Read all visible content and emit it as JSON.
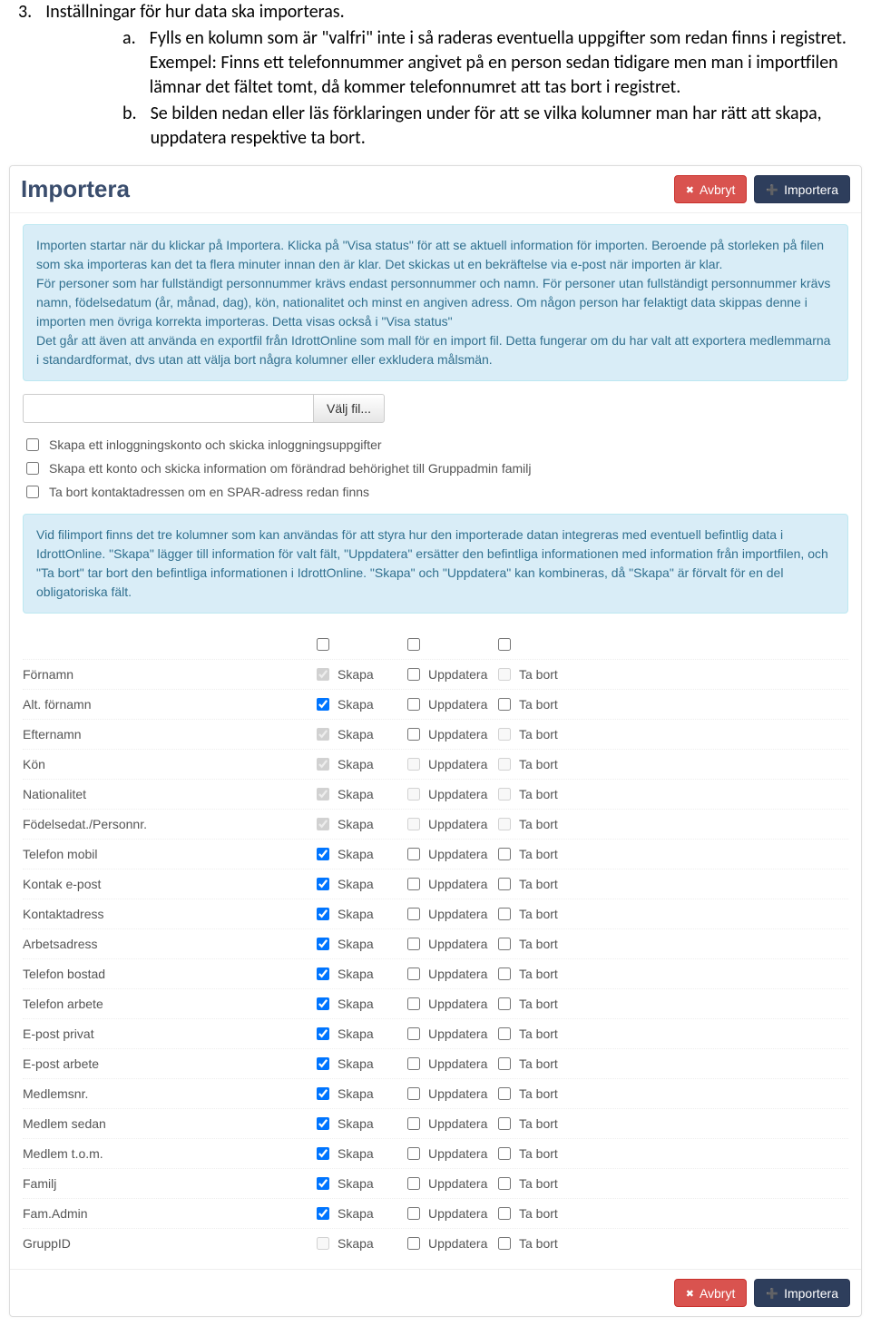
{
  "doc": {
    "item_number": "3.",
    "item_text": "Inställningar för hur data ska importeras.",
    "letter_a": "a.",
    "text_a": "Fylls en kolumn som är \"valfri\" inte i så raderas eventuella uppgifter som redan finns i registret. Exempel: Finns ett telefonnummer angivet på en person sedan tidigare men man i importfilen lämnar det fältet tomt, då kommer telefonnumret att tas bort i registret.",
    "letter_b": "b.",
    "text_b": "Se bilden nedan eller läs förklaringen under för att se vilka kolumner man har rätt att skapa, uppdatera respektive ta bort."
  },
  "panel": {
    "title": "Importera",
    "cancel_label": "Avbryt",
    "import_label": "Importera",
    "info1": "Importen startar när du klickar på Importera. Klicka på \"Visa status\" för att se aktuell information för importen. Beroende på storleken på filen som ska importeras kan det ta flera minuter innan den är klar. Det skickas ut en bekräftelse via e-post när importen är klar.\nFör personer som har fullständigt personnummer krävs endast personnummer och namn. För personer utan fullständigt personnummer krävs namn, födelsedatum (år, månad, dag), kön, nationalitet och minst en angiven adress. Om någon person har felaktigt data skippas denne i importen men övriga korrekta importeras. Detta visas också i \"Visa status\"\nDet går att även att använda en exportfil från IdrottOnline som mall för en import fil. Detta fungerar om du har valt att exportera medlemmarna i standardformat, dvs utan att välja bort några kolumner eller exkludera målsmän.",
    "choose_file": "Välj fil...",
    "check1": "Skapa ett inloggningskonto och skicka inloggningsuppgifter",
    "check2": "Skapa ett konto och skicka information om förändrad behörighet till Gruppadmin familj",
    "check3": "Ta bort kontaktadressen om en SPAR-adress redan finns",
    "info2": "Vid filimport finns det tre kolumner som kan användas för att styra hur den importerade datan integreras med eventuell befintlig data i IdrottOnline. \"Skapa\" lägger till information för valt fält, \"Uppdatera\" ersätter den befintliga informationen med information från importfilen, och \"Ta bort\" tar bort den befintliga informationen i IdrottOnline. \"Skapa\" och \"Uppdatera\" kan kombineras, då \"Skapa\" är förvalt för en del obligatoriska fält.",
    "col_skapa": "Skapa",
    "col_uppdatera": "Uppdatera",
    "col_tabort": "Ta bort",
    "rows": [
      {
        "label": "Förnamn",
        "skapa": true,
        "skapa_enabled": false,
        "uppdatera": false,
        "uppdatera_enabled": true,
        "tabort": false,
        "tabort_enabled": false
      },
      {
        "label": "Alt. förnamn",
        "skapa": true,
        "skapa_enabled": true,
        "uppdatera": false,
        "uppdatera_enabled": true,
        "tabort": false,
        "tabort_enabled": true
      },
      {
        "label": "Efternamn",
        "skapa": true,
        "skapa_enabled": false,
        "uppdatera": false,
        "uppdatera_enabled": true,
        "tabort": false,
        "tabort_enabled": false
      },
      {
        "label": "Kön",
        "skapa": true,
        "skapa_enabled": false,
        "uppdatera": false,
        "uppdatera_enabled": false,
        "tabort": false,
        "tabort_enabled": false
      },
      {
        "label": "Nationalitet",
        "skapa": true,
        "skapa_enabled": false,
        "uppdatera": false,
        "uppdatera_enabled": false,
        "tabort": false,
        "tabort_enabled": false
      },
      {
        "label": "Födelsedat./Personnr.",
        "skapa": true,
        "skapa_enabled": false,
        "uppdatera": false,
        "uppdatera_enabled": false,
        "tabort": false,
        "tabort_enabled": false
      },
      {
        "label": "Telefon mobil",
        "skapa": true,
        "skapa_enabled": true,
        "uppdatera": false,
        "uppdatera_enabled": true,
        "tabort": false,
        "tabort_enabled": true
      },
      {
        "label": "Kontak e-post",
        "skapa": true,
        "skapa_enabled": true,
        "uppdatera": false,
        "uppdatera_enabled": true,
        "tabort": false,
        "tabort_enabled": true
      },
      {
        "label": "Kontaktadress",
        "skapa": true,
        "skapa_enabled": true,
        "uppdatera": false,
        "uppdatera_enabled": true,
        "tabort": false,
        "tabort_enabled": true
      },
      {
        "label": "Arbetsadress",
        "skapa": true,
        "skapa_enabled": true,
        "uppdatera": false,
        "uppdatera_enabled": true,
        "tabort": false,
        "tabort_enabled": true
      },
      {
        "label": "Telefon bostad",
        "skapa": true,
        "skapa_enabled": true,
        "uppdatera": false,
        "uppdatera_enabled": true,
        "tabort": false,
        "tabort_enabled": true
      },
      {
        "label": "Telefon arbete",
        "skapa": true,
        "skapa_enabled": true,
        "uppdatera": false,
        "uppdatera_enabled": true,
        "tabort": false,
        "tabort_enabled": true
      },
      {
        "label": "E-post privat",
        "skapa": true,
        "skapa_enabled": true,
        "uppdatera": false,
        "uppdatera_enabled": true,
        "tabort": false,
        "tabort_enabled": true
      },
      {
        "label": "E-post arbete",
        "skapa": true,
        "skapa_enabled": true,
        "uppdatera": false,
        "uppdatera_enabled": true,
        "tabort": false,
        "tabort_enabled": true
      },
      {
        "label": "Medlemsnr.",
        "skapa": true,
        "skapa_enabled": true,
        "uppdatera": false,
        "uppdatera_enabled": true,
        "tabort": false,
        "tabort_enabled": true
      },
      {
        "label": "Medlem sedan",
        "skapa": true,
        "skapa_enabled": true,
        "uppdatera": false,
        "uppdatera_enabled": true,
        "tabort": false,
        "tabort_enabled": true
      },
      {
        "label": "Medlem t.o.m.",
        "skapa": true,
        "skapa_enabled": true,
        "uppdatera": false,
        "uppdatera_enabled": true,
        "tabort": false,
        "tabort_enabled": true
      },
      {
        "label": "Familj",
        "skapa": true,
        "skapa_enabled": true,
        "uppdatera": false,
        "uppdatera_enabled": true,
        "tabort": false,
        "tabort_enabled": true
      },
      {
        "label": "Fam.Admin",
        "skapa": true,
        "skapa_enabled": true,
        "uppdatera": false,
        "uppdatera_enabled": true,
        "tabort": false,
        "tabort_enabled": true
      },
      {
        "label": "GruppID",
        "skapa": false,
        "skapa_enabled": false,
        "uppdatera": false,
        "uppdatera_enabled": true,
        "tabort": false,
        "tabort_enabled": true
      }
    ]
  }
}
